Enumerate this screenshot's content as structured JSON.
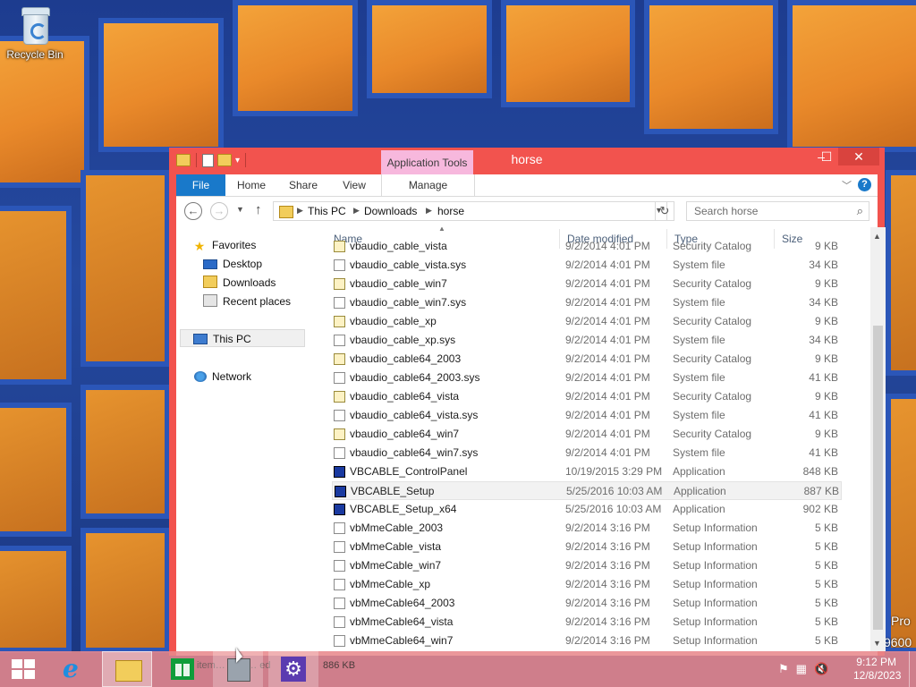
{
  "desktop": {
    "icons": [
      {
        "label": "Recycle Bin",
        "icon": "recycle-bin-icon"
      }
    ],
    "edge_text": [
      "Pro",
      "9600"
    ]
  },
  "window": {
    "title": "horse",
    "context_tab": "Application Tools",
    "colors": {
      "frame": "#f2534e",
      "file_tab": "#1979ca",
      "context_tab": "#f7b8dd"
    },
    "ribbon_tabs": [
      "File",
      "Home",
      "Share",
      "View",
      "Manage"
    ],
    "breadcrumb": [
      "This PC",
      "Downloads",
      "horse"
    ],
    "search_placeholder": "Search horse",
    "nav": {
      "favorites": "Favorites",
      "desktop": "Desktop",
      "downloads": "Downloads",
      "recent": "Recent places",
      "this_pc": "This PC",
      "network": "Network"
    },
    "columns": {
      "name": "Name",
      "date": "Date modified",
      "type": "Type",
      "size": "Size"
    },
    "files": [
      {
        "name": "vbaudio_cable_vista",
        "date": "9/2/2014 4:01 PM",
        "type": "Security Catalog",
        "size": "9 KB",
        "kind": "cat"
      },
      {
        "name": "vbaudio_cable_vista.sys",
        "date": "9/2/2014 4:01 PM",
        "type": "System file",
        "size": "34 KB",
        "kind": "sys"
      },
      {
        "name": "vbaudio_cable_win7",
        "date": "9/2/2014 4:01 PM",
        "type": "Security Catalog",
        "size": "9 KB",
        "kind": "cat"
      },
      {
        "name": "vbaudio_cable_win7.sys",
        "date": "9/2/2014 4:01 PM",
        "type": "System file",
        "size": "34 KB",
        "kind": "sys"
      },
      {
        "name": "vbaudio_cable_xp",
        "date": "9/2/2014 4:01 PM",
        "type": "Security Catalog",
        "size": "9 KB",
        "kind": "cat"
      },
      {
        "name": "vbaudio_cable_xp.sys",
        "date": "9/2/2014 4:01 PM",
        "type": "System file",
        "size": "34 KB",
        "kind": "sys"
      },
      {
        "name": "vbaudio_cable64_2003",
        "date": "9/2/2014 4:01 PM",
        "type": "Security Catalog",
        "size": "9 KB",
        "kind": "cat"
      },
      {
        "name": "vbaudio_cable64_2003.sys",
        "date": "9/2/2014 4:01 PM",
        "type": "System file",
        "size": "41 KB",
        "kind": "sys"
      },
      {
        "name": "vbaudio_cable64_vista",
        "date": "9/2/2014 4:01 PM",
        "type": "Security Catalog",
        "size": "9 KB",
        "kind": "cat"
      },
      {
        "name": "vbaudio_cable64_vista.sys",
        "date": "9/2/2014 4:01 PM",
        "type": "System file",
        "size": "41 KB",
        "kind": "sys"
      },
      {
        "name": "vbaudio_cable64_win7",
        "date": "9/2/2014 4:01 PM",
        "type": "Security Catalog",
        "size": "9 KB",
        "kind": "cat"
      },
      {
        "name": "vbaudio_cable64_win7.sys",
        "date": "9/2/2014 4:01 PM",
        "type": "System file",
        "size": "41 KB",
        "kind": "sys"
      },
      {
        "name": "VBCABLE_ControlPanel",
        "date": "10/19/2015 3:29 PM",
        "type": "Application",
        "size": "848 KB",
        "kind": "app"
      },
      {
        "name": "VBCABLE_Setup",
        "date": "5/25/2016 10:03 AM",
        "type": "Application",
        "size": "887 KB",
        "kind": "app",
        "selected": true
      },
      {
        "name": "VBCABLE_Setup_x64",
        "date": "5/25/2016 10:03 AM",
        "type": "Application",
        "size": "902 KB",
        "kind": "app"
      },
      {
        "name": "vbMmeCable_2003",
        "date": "9/2/2014 3:16 PM",
        "type": "Setup Information",
        "size": "5 KB",
        "kind": "inf"
      },
      {
        "name": "vbMmeCable_vista",
        "date": "9/2/2014 3:16 PM",
        "type": "Setup Information",
        "size": "5 KB",
        "kind": "inf"
      },
      {
        "name": "vbMmeCable_win7",
        "date": "9/2/2014 3:16 PM",
        "type": "Setup Information",
        "size": "5 KB",
        "kind": "inf"
      },
      {
        "name": "vbMmeCable_xp",
        "date": "9/2/2014 3:16 PM",
        "type": "Setup Information",
        "size": "5 KB",
        "kind": "inf"
      },
      {
        "name": "vbMmeCable64_2003",
        "date": "9/2/2014 3:16 PM",
        "type": "Setup Information",
        "size": "5 KB",
        "kind": "inf"
      },
      {
        "name": "vbMmeCable64_vista",
        "date": "9/2/2014 3:16 PM",
        "type": "Setup Information",
        "size": "5 KB",
        "kind": "inf"
      },
      {
        "name": "vbMmeCable64_win7",
        "date": "9/2/2014 3:16 PM",
        "type": "Setup Information",
        "size": "5 KB",
        "kind": "inf"
      }
    ],
    "status_ghost": "item… ham… ed",
    "status_size": "886 KB"
  },
  "taskbar": {
    "time": "9:12 PM",
    "date": "12/8/2023",
    "color": "#e8898c",
    "pinned": [
      "start-icon",
      "internet-explorer-icon",
      "file-explorer-icon",
      "store-icon",
      "setup-icon",
      "control-panel-icon"
    ]
  }
}
